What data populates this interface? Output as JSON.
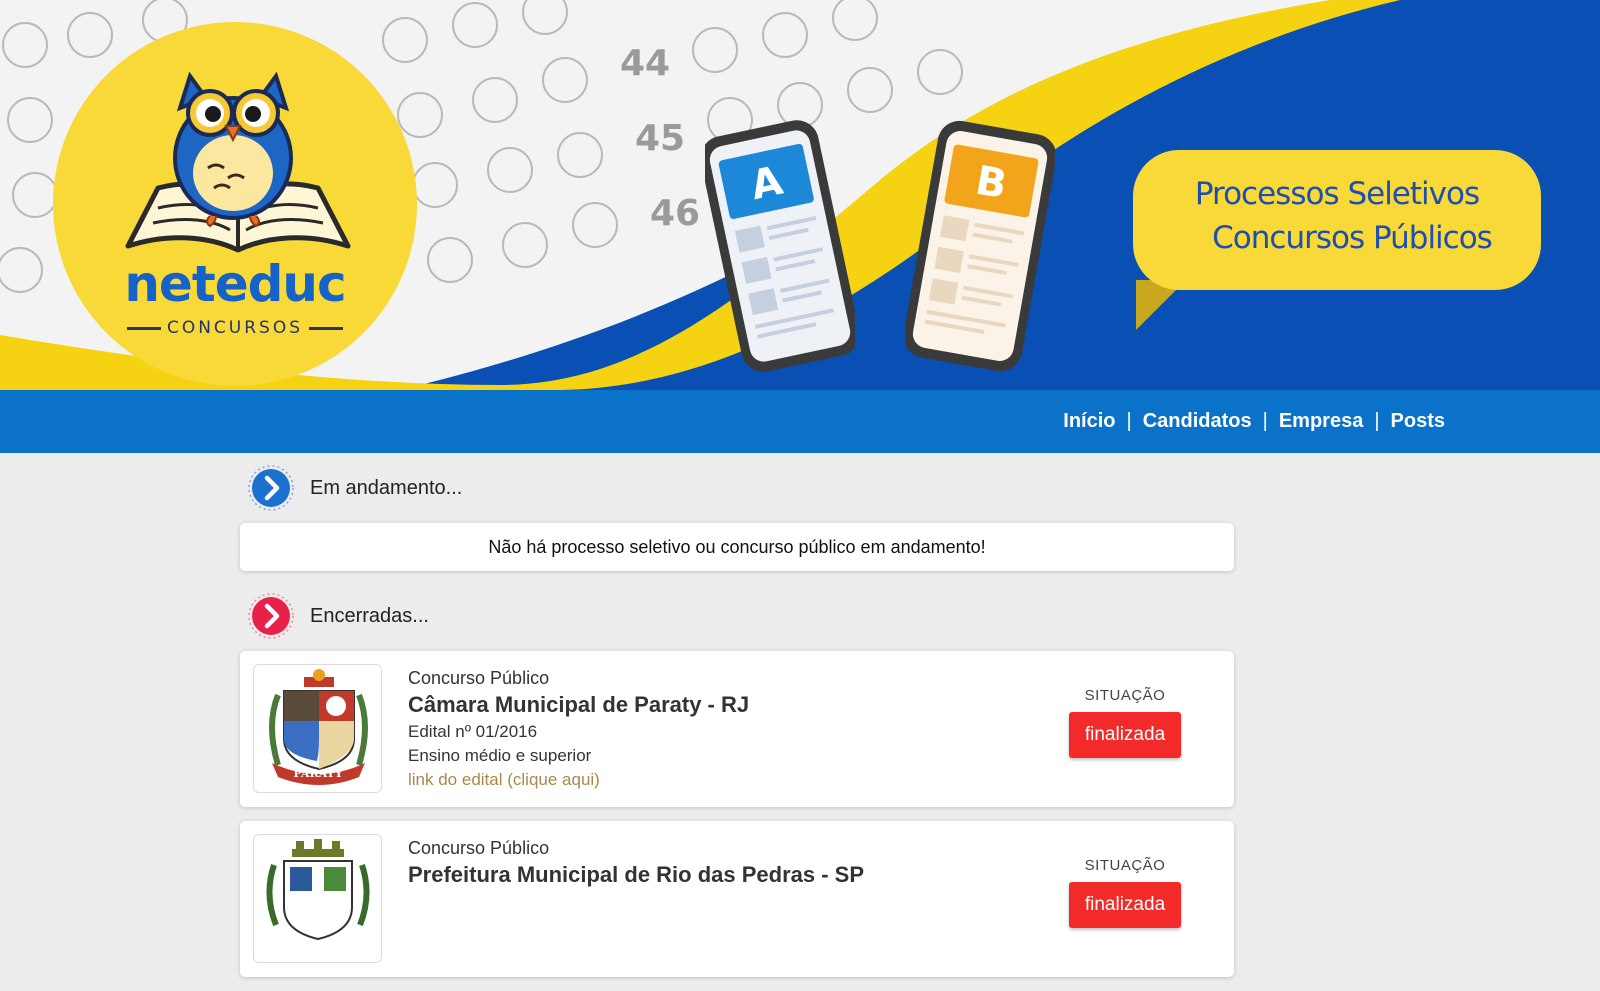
{
  "brand": {
    "name": "neteduc",
    "sub": "CONCURSOS"
  },
  "banner": {
    "speech_line1": "Processos Seletivos",
    "speech_line2": "Concursos Públicos",
    "phone_a": "A",
    "phone_b": "B",
    "answer_sheet_numbers": [
      "44",
      "45",
      "46"
    ],
    "colors": {
      "blue": "#0a4fb3",
      "yellow": "#f8d938",
      "nav": "#0a72c9"
    }
  },
  "nav": {
    "items": [
      "Início",
      "Candidatos",
      "Empresa",
      "Posts"
    ],
    "separator": "|"
  },
  "sections": {
    "ongoing": {
      "heading": "Em andamento...",
      "empty_message": "Não há processo seletivo ou concurso público em andamento!"
    },
    "closed": {
      "heading": "Encerradas..."
    }
  },
  "contests": [
    {
      "type": "Concurso Público",
      "title": "Câmara Municipal de Paraty - RJ",
      "edital": "Edital nº 01/2016",
      "level": "Ensino médio e superior",
      "link": "link do edital (clique aqui)",
      "status_label": "SITUAÇÃO",
      "status": "finalizada",
      "crest_text": "PARATY"
    },
    {
      "type": "Concurso Público",
      "title": "Prefeitura Municipal de Rio das Pedras - SP",
      "status_label": "SITUAÇÃO",
      "status": "finalizada"
    }
  ]
}
